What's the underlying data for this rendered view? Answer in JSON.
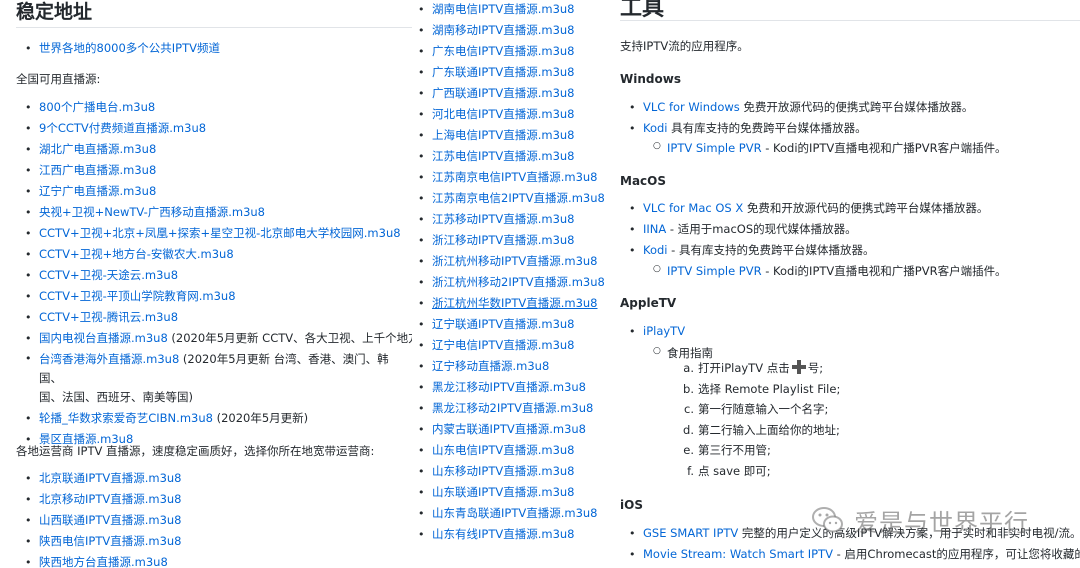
{
  "col1": {
    "heading": "稳定地址",
    "list_a": [
      {
        "link": "世界各地的8000多个公共IPTV频道",
        "suffix": ""
      }
    ],
    "para1": "全国可用直播源:",
    "list_b": [
      {
        "link": "800个广播电台.m3u8",
        "suffix": ""
      },
      {
        "link": "9个CCTV付费频道直播源.m3u8",
        "suffix": ""
      },
      {
        "link": "湖北广电直播源.m3u8",
        "suffix": ""
      },
      {
        "link": "江西广电直播源.m3u8",
        "suffix": ""
      },
      {
        "link": "辽宁广电直播源.m3u8",
        "suffix": ""
      },
      {
        "link": "央视+卫视+NewTV-广西移动直播源.m3u8",
        "suffix": ""
      },
      {
        "link": "CCTV+卫视+北京+凤凰+探索+星空卫视-北京邮电大学校园网.m3u8",
        "suffix": ""
      },
      {
        "link": "CCTV+卫视+地方台-安徽农大.m3u8",
        "suffix": ""
      },
      {
        "link": "CCTV+卫视-天途云.m3u8",
        "suffix": ""
      },
      {
        "link": "CCTV+卫视-平顶山学院教育网.m3u8",
        "suffix": ""
      },
      {
        "link": "CCTV+卫视-腾讯云.m3u8",
        "suffix": ""
      },
      {
        "link": "国内电视台直播源.m3u8",
        "suffix": " (2020年5月更新 CCTV、各大卫视、上千个地方"
      },
      {
        "link": "台湾香港海外直播源.m3u8",
        "suffix": " (2020年5月更新 台湾、香港、澳门、韩国、",
        "wrap": "国、法国、西班牙、南美等国)"
      },
      {
        "link": "轮播_华数求索爱奇艺CIBN.m3u8",
        "suffix": " (2020年5月更新)"
      },
      {
        "link": "景区直播源.m3u8",
        "suffix": ""
      }
    ],
    "para2": "各地运营商 IPTV 直播源，速度稳定画质好，选择你所在地宽带运营商:",
    "list_c": [
      "北京联通IPTV直播源.m3u8",
      "北京移动IPTV直播源.m3u8",
      "山西联通IPTV直播源.m3u8",
      "陕西电信IPTV直播源.m3u8",
      "陕西地方台直播源.m3u8"
    ]
  },
  "col2": {
    "items": [
      "湖南电信IPTV直播源.m3u8",
      "湖南移动IPTV直播源.m3u8",
      "广东电信IPTV直播源.m3u8",
      "广东联通IPTV直播源.m3u8",
      "广西联通IPTV直播源.m3u8",
      "河北电信IPTV直播源.m3u8",
      "上海电信IPTV直播源.m3u8",
      "江苏电信IPTV直播源.m3u8",
      "江苏南京电信IPTV直播源.m3u8",
      "江苏南京电信2IPTV直播源.m3u8",
      "江苏移动IPTV直播源.m3u8",
      "浙江移动IPTV直播源.m3u8",
      "浙江杭州移动IPTV直播源.m3u8",
      "浙江杭州移动2IPTV直播源.m3u8",
      "浙江杭州华数IPTV直播源.m3u8",
      "辽宁联通IPTV直播源.m3u8",
      "辽宁电信IPTV直播源.m3u8",
      "辽宁移动直播源.m3u8",
      "黑龙江移动IPTV直播源.m3u8",
      "黑龙江移动2IPTV直播源.m3u8",
      "内蒙古联通IPTV直播源.m3u8",
      "山东电信IPTV直播源.m3u8",
      "山东移动IPTV直播源.m3u8",
      "山东联通IPTV直播源.m3u8",
      "山东青岛联通IPTV直播源.m3u8",
      "山东有线IPTV直播源.m3u8"
    ],
    "underlined_index": 14
  },
  "col3": {
    "heading": "工具",
    "intro": "支持IPTV流的应用程序。",
    "windows": {
      "title": "Windows",
      "vlc_link": "VLC for Windows",
      "vlc_desc": " 免费开放源代码的便携式跨平台媒体播放器。",
      "kodi_link": "Kodi",
      "kodi_desc": " 具有库支持的免费跨平台媒体播放器。",
      "pvr_link": "IPTV Simple PVR",
      "pvr_desc": " - Kodi的IPTV直播电视和广播PVR客户端插件。"
    },
    "macos": {
      "title": "MacOS",
      "vlc_link": "VLC for Mac OS X",
      "vlc_desc": " 免费和开放源代码的便携式跨平台媒体播放器。",
      "iina_link": "IINA",
      "iina_desc": " - 适用于macOS的现代媒体播放器。",
      "kodi_link": "Kodi",
      "kodi_desc": " - 具有库支持的免费跨平台媒体播放器。",
      "pvr_link": "IPTV Simple PVR",
      "pvr_desc": " - Kodi的IPTV直播电视和广播PVR客户端插件。"
    },
    "appletv": {
      "title": "AppleTV",
      "app_link": "iPlayTV",
      "guide": "食用指南",
      "step_a_pre": "打开iPlayTV 点击",
      "step_a_post": "号;",
      "steps": [
        {
          "label": "a.",
          "text": ""
        },
        {
          "label": "b.",
          "text": "选择 Remote Playlist File;"
        },
        {
          "label": "c.",
          "text": "第一行随意输入一个名字;"
        },
        {
          "label": "d.",
          "text": "第二行输入上面给你的地址;"
        },
        {
          "label": "e.",
          "text": "第三行不用管;"
        },
        {
          "label": "f.",
          "text": "点 save 即可;"
        }
      ]
    },
    "ios": {
      "title": "iOS",
      "gse_link": "GSE SMART IPTV",
      "gse_desc": " 完整的用户定义的高级IPTV解决方案，用于实时和非实时电视/流。",
      "movie_link": "Movie Stream: Watch Smart IPTV",
      "movie_desc": " - 启用Chromecast的应用程序，可让您将收藏的视频"
    }
  },
  "watermark": {
    "text": "爱是与世界平行"
  }
}
